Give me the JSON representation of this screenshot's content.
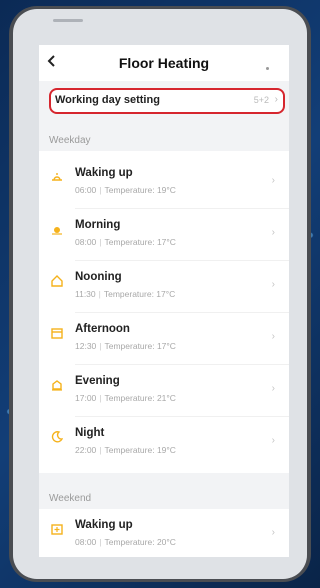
{
  "header": {
    "title": "Floor Heating",
    "back_icon": "chevron-left-icon"
  },
  "working_day": {
    "label": "Working day setting",
    "value": "5+2",
    "chevron": "›"
  },
  "weekday": {
    "label": "Weekday",
    "items": [
      {
        "title": "Waking up",
        "time": "06:00",
        "temp": "Temperature: 19°C",
        "icon": "sunrise-icon"
      },
      {
        "title": "Morning",
        "time": "08:00",
        "temp": "Temperature: 17°C",
        "icon": "sun-icon"
      },
      {
        "title": "Nooning",
        "time": "11:30",
        "temp": "Temperature: 17°C",
        "icon": "home-icon"
      },
      {
        "title": "Afternoon",
        "time": "12:30",
        "temp": "Temperature: 17°C",
        "icon": "calendar-icon"
      },
      {
        "title": "Evening",
        "time": "17:00",
        "temp": "Temperature: 21°C",
        "icon": "house-icon"
      },
      {
        "title": "Night",
        "time": "22:00",
        "temp": "Temperature: 19°C",
        "icon": "moon-icon"
      }
    ]
  },
  "weekend": {
    "label": "Weekend",
    "items": [
      {
        "title": "Waking up",
        "time": "08:00",
        "temp": "Temperature: 20°C",
        "icon": "sunrise-icon"
      }
    ]
  },
  "colors": {
    "accent": "#f5b21c",
    "highlight": "#d6262e"
  }
}
